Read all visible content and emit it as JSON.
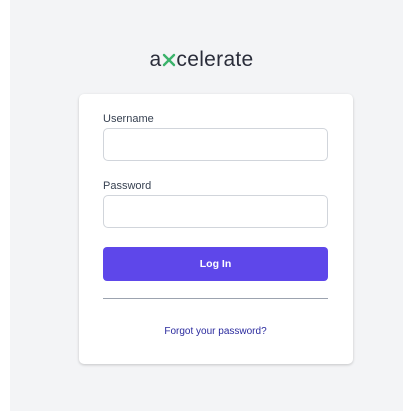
{
  "brand": {
    "prefix": "a",
    "suffix": "celerate",
    "accent_color": "#3ab26a",
    "text_color": "#2a2d3a"
  },
  "form": {
    "username_label": "Username",
    "username_value": "",
    "password_label": "Password",
    "password_value": "",
    "login_label": "Log In",
    "forgot_label": "Forgot your password?"
  },
  "colors": {
    "button": "#5e47ea",
    "link": "#2a2a9e",
    "background": "#f3f4f6"
  }
}
